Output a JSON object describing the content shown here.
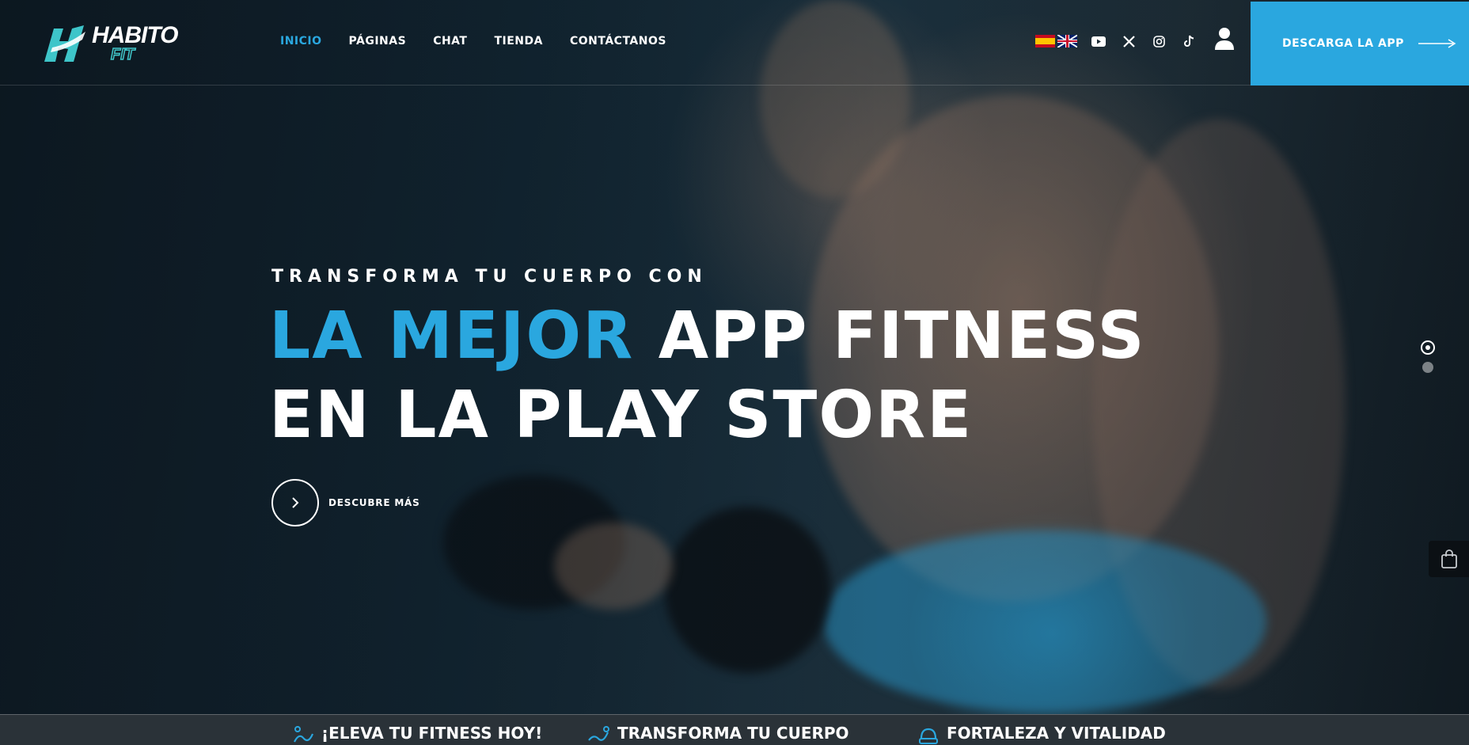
{
  "brand": {
    "name_line1": "HABITO",
    "name_line2": "FIT",
    "accent_color": "#2aa7df",
    "logo_color": "#3ec5c9"
  },
  "nav": {
    "items": [
      {
        "label": "INICIO",
        "active": true
      },
      {
        "label": "PÁGINAS",
        "active": false
      },
      {
        "label": "CHAT",
        "active": false
      },
      {
        "label": "TIENDA",
        "active": false
      },
      {
        "label": "CONTÁCTANOS",
        "active": false
      }
    ]
  },
  "header": {
    "languages": [
      "flag-es-icon",
      "flag-uk-icon"
    ],
    "social": [
      "youtube-icon",
      "x-twitter-icon",
      "instagram-icon",
      "tiktok-icon"
    ],
    "user_icon": "user-icon",
    "download_label": "DESCARGA LA APP"
  },
  "hero": {
    "eyebrow": "TRANSFORMA TU CUERPO CON",
    "headline_accent": "LA MEJOR",
    "headline_rest": " APP FITNESS",
    "headline_line2": "EN LA PLAY STORE",
    "cta_label": "DESCUBRE MÁS",
    "slides_total": 2,
    "active_slide": 1
  },
  "features": [
    {
      "label": "¡ELEVA TU FITNESS HOY!",
      "icon": "fitness-icon"
    },
    {
      "label": "TRANSFORMA TU CUERPO",
      "icon": "body-icon"
    },
    {
      "label": "FORTALEZA Y VITALIDAD",
      "icon": "strength-icon"
    }
  ]
}
